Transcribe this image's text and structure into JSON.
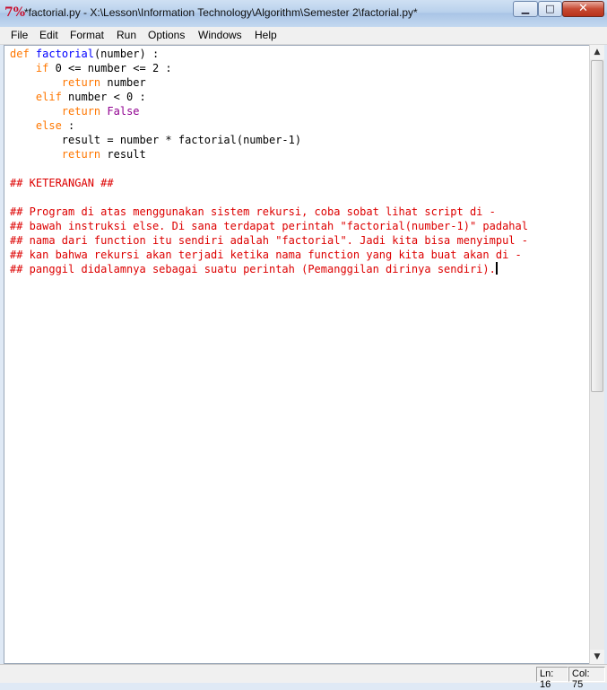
{
  "window": {
    "title": "*factorial.py - X:\\Lesson\\Information Technology\\Algorithm\\Semester 2\\factorial.py*",
    "icon": "python-idle-icon",
    "controls": {
      "minimize": "▁",
      "maximize": "□",
      "close": "✕"
    }
  },
  "menu": [
    "File",
    "Edit",
    "Format",
    "Run",
    "Options",
    "Windows",
    "Help"
  ],
  "code": {
    "l1_kw": "def",
    "l1_fn": "factorial",
    "l1_rest": "(number) :",
    "l2_kw": "if",
    "l2_rest": " 0 <= number <= 2 :",
    "l3_kw": "return",
    "l3_rest": " number",
    "l4_kw": "elif",
    "l4_rest": " number < 0 :",
    "l5_kw": "return",
    "l5_bi": "False",
    "l6_kw": "else",
    "l6_rest": " :",
    "l7": "result = number * factorial(number-1)",
    "l8_kw": "return",
    "l8_rest": " result",
    "c1": "## KETERANGAN ##",
    "c2": "## Program di atas menggunakan sistem rekursi, coba sobat lihat script di -",
    "c3": "## bawah instruksi else. Di sana terdapat perintah \"factorial(number-1)\" padahal",
    "c4": "## nama dari function itu sendiri adalah \"factorial\". Jadi kita bisa menyimpul -",
    "c5": "## kan bahwa rekursi akan terjadi ketika nama function yang kita buat akan di -",
    "c6": "## panggil didalamnya sebagai suatu perintah (Pemanggilan dirinya sendiri)."
  },
  "status": {
    "line": "Ln: 16",
    "col": "Col: 75"
  },
  "colors": {
    "keyword": "#ff7700",
    "function_name": "#0000ff",
    "builtin": "#900090",
    "comment": "#dd0000"
  }
}
